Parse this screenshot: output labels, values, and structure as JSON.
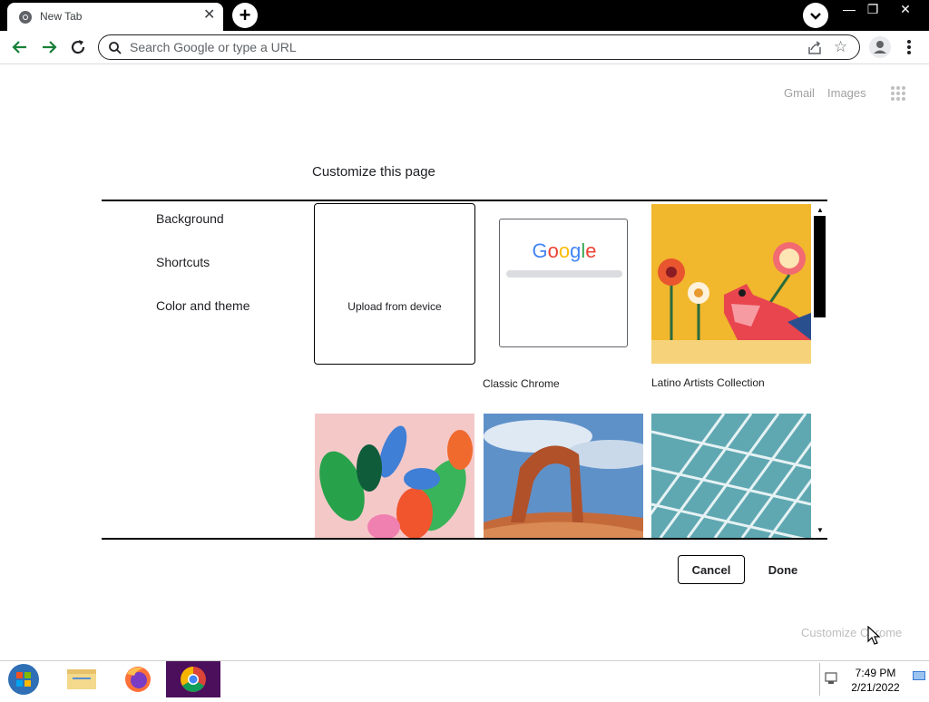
{
  "browser": {
    "tab_title": "New Tab",
    "tab_close": "✕",
    "new_tab": "+",
    "window_controls": {
      "minimize": "—",
      "restore": "❐",
      "close": "✕"
    },
    "omnibox_placeholder": "Search Google or type a URL",
    "star": "☆"
  },
  "ntp": {
    "gmail": "Gmail",
    "images": "Images",
    "customize_link": "Customize Chrome"
  },
  "dialog": {
    "title": "Customize this page",
    "menu": [
      "Background",
      "Shortcuts",
      "Color and theme"
    ],
    "tiles": {
      "upload_label": "Upload from device",
      "classic_label": "Classic Chrome",
      "latino_label": "Latino Artists Collection",
      "google_logo": "Google"
    },
    "scroll_up": "▲",
    "scroll_down": "▼",
    "cancel": "Cancel",
    "done": "Done"
  },
  "taskbar": {
    "time": "7:49 PM",
    "date": "2/21/2022"
  },
  "colors": {
    "titlebar": "#000000",
    "chrome_taskbar_active": "#4b0f5c",
    "link_grey": "#a0a0a0"
  }
}
